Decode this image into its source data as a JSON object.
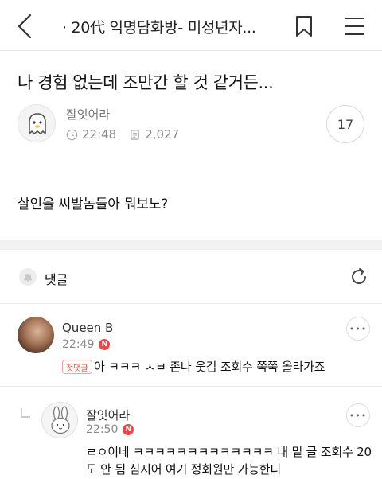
{
  "appbar": {
    "title": "· 20代 익명담화방- 미성년자..."
  },
  "post": {
    "title": "나 경험 없는데 조만간 할 것 같거든...",
    "author": "잘잇어라",
    "time": "22:48",
    "views": "2,027",
    "comment_count": "17",
    "body": "살인을 씨발놈들아 뭐보노?"
  },
  "comments_section": {
    "label": "댓글"
  },
  "comments": [
    {
      "author": "Queen B",
      "time": "22:49",
      "new_badge": "N",
      "first_badge": "첫댓글",
      "text": "아 ㅋㅋㅋ ㅅㅂ 존나 웃김 조회수 쭉쭉 올라가죠"
    },
    {
      "author": "잘잇어라",
      "time": "22:50",
      "new_badge": "N",
      "text": "ㄹㅇ이네 ㅋㅋㅋㅋㅋㅋㅋㅋㅋㅋㅋㅋㅋ 내 밑 글 조회수 20도 안 됨 심지어 여기 정회원만 가능한디"
    }
  ],
  "icons": {
    "back": "chevron-left-icon",
    "bookmark": "bookmark-icon",
    "menu": "hamburger-menu-icon",
    "clock": "clock-icon",
    "views": "document-icon",
    "bell": "bell-icon",
    "refresh": "refresh-icon",
    "more": "more-dots-icon",
    "reply": "reply-arrow-icon"
  },
  "colors": {
    "badge_red": "#e8474a",
    "muted_text": "#888888"
  }
}
